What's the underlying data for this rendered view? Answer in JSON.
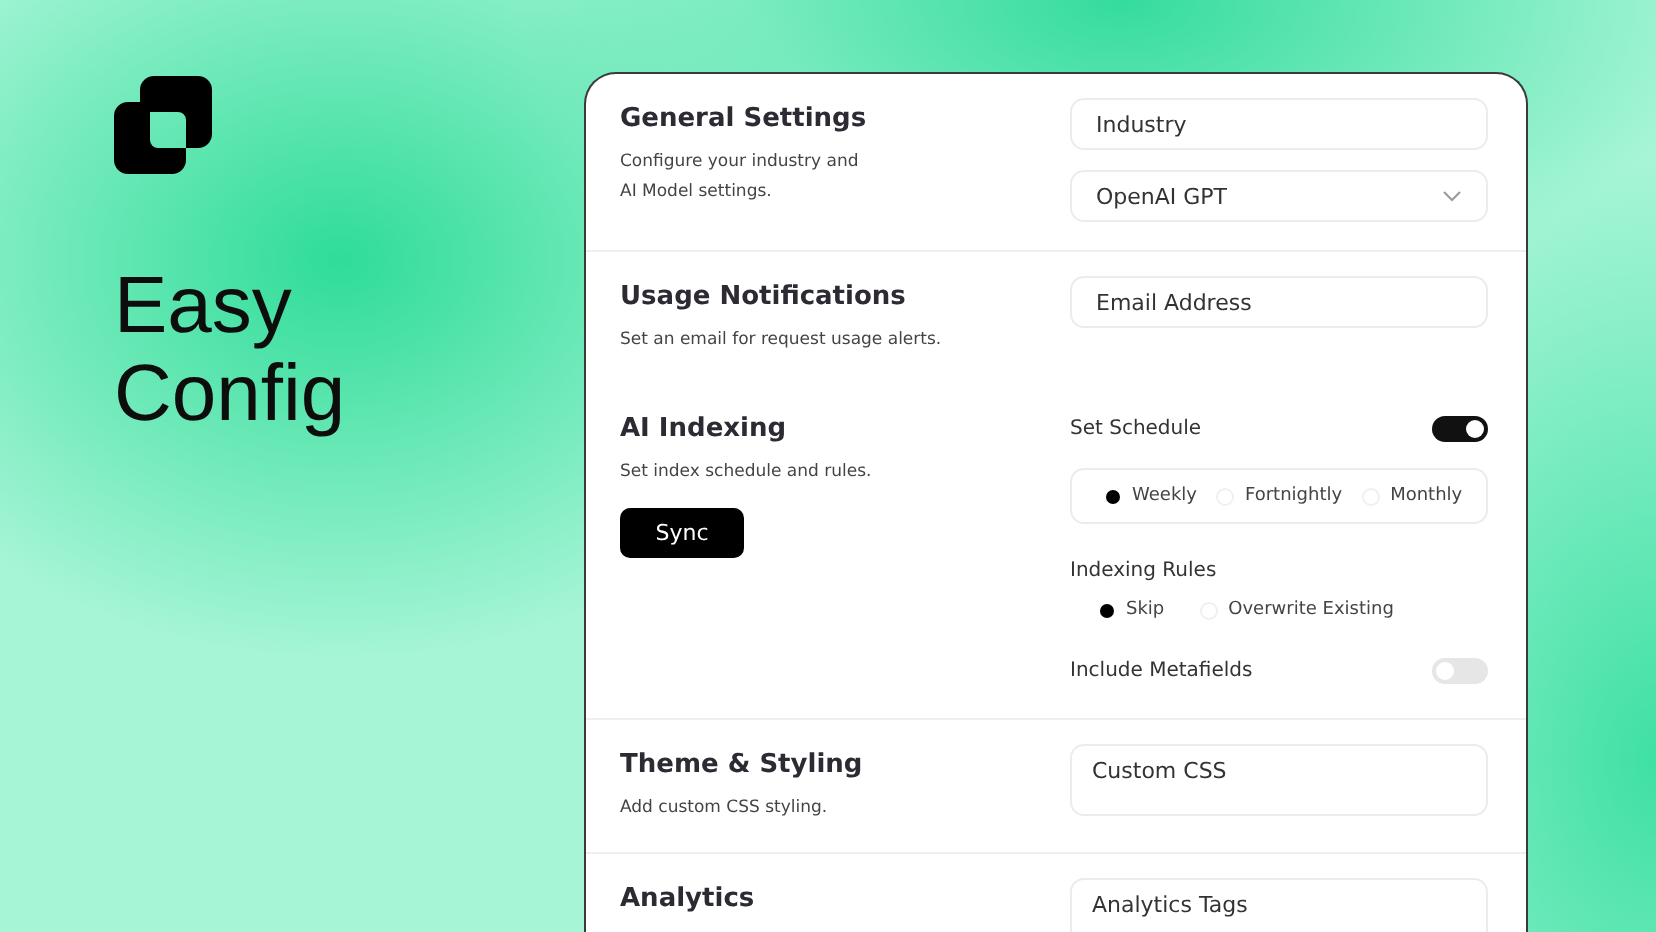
{
  "brand": {
    "headline": [
      "Easy",
      "Config"
    ]
  },
  "sections": [
    {
      "title": "General Settings",
      "description": [
        "Configure your industry and",
        "AI Model settings."
      ],
      "divider_after": true,
      "controls": [
        {
          "kind": "field",
          "placeholder": "Industry"
        },
        {
          "kind": "select",
          "value": "OpenAI GPT"
        }
      ]
    },
    {
      "title": "Usage Notifications",
      "description": [
        "Set an email for request usage alerts."
      ],
      "divider_after": false,
      "controls": [
        {
          "kind": "field",
          "placeholder": "Email Address"
        }
      ]
    },
    {
      "title": "AI Indexing",
      "description": [
        "Set index schedule and rules."
      ],
      "button": "Sync",
      "divider_after": true,
      "controls": [
        {
          "kind": "toggle",
          "label": "Set Schedule",
          "on": true
        },
        {
          "kind": "radio_group",
          "boxed": true,
          "options": [
            {
              "label": "Weekly",
              "selected": true
            },
            {
              "label": "Fortnightly",
              "selected": false
            },
            {
              "label": "Monthly",
              "selected": false
            }
          ]
        },
        {
          "kind": "radio_group",
          "boxed": false,
          "label": "Indexing Rules",
          "options": [
            {
              "label": "Skip",
              "selected": true
            },
            {
              "label": "Overwrite Existing",
              "selected": false
            }
          ]
        },
        {
          "kind": "toggle",
          "label": "Include Metafields",
          "on": false
        }
      ]
    },
    {
      "title": "Theme & Styling",
      "description": [
        "Add custom CSS styling."
      ],
      "divider_after": true,
      "controls": [
        {
          "kind": "textarea",
          "placeholder": "Custom CSS"
        }
      ]
    },
    {
      "title": "Analytics",
      "divider_after": false,
      "controls": [
        {
          "kind": "textarea",
          "placeholder": "Analytics Tags"
        }
      ]
    }
  ]
}
